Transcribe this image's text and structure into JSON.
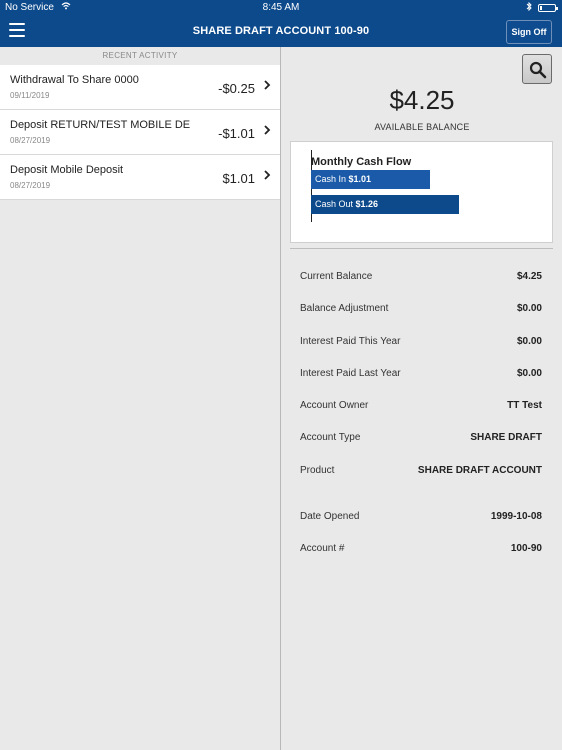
{
  "status_bar": {
    "carrier": "No Service",
    "time": "8:45 AM",
    "battery_level": 0.15
  },
  "header": {
    "title": "SHARE DRAFT ACCOUNT 100-90",
    "sign_off_label": "Sign Off",
    "background_color": "#0d4a8c"
  },
  "recent_activity": {
    "heading": "RECENT ACTIVITY",
    "items": [
      {
        "description": "Withdrawal To Share 0000",
        "date": "09/11/2019",
        "amount": "-$0.25"
      },
      {
        "description": "Deposit RETURN/TEST MOBILE DE",
        "date": "08/27/2019",
        "amount": "-$1.01"
      },
      {
        "description": "Deposit Mobile Deposit",
        "date": "08/27/2019",
        "amount": "$1.01"
      }
    ]
  },
  "summary": {
    "available_balance": "$4.25",
    "available_balance_label": "AVAILABLE BALANCE"
  },
  "cash_flow": {
    "title": "Monthly Cash Flow",
    "cash_in_label": "Cash In",
    "cash_in_value": "$1.01",
    "cash_out_label": "Cash Out",
    "cash_out_value": "$1.26",
    "cash_in_amount": 1.01,
    "cash_out_amount": 1.26,
    "cash_in_color": "#1a5aa8",
    "cash_out_color": "#0d4a8c"
  },
  "details": [
    {
      "label": "Current Balance",
      "value": "$4.25"
    },
    {
      "label": "Balance Adjustment",
      "value": "$0.00"
    },
    {
      "label": "Interest Paid This Year",
      "value": "$0.00"
    },
    {
      "label": "Interest Paid Last Year",
      "value": "$0.00"
    },
    {
      "label": "Account Owner",
      "value": "TT Test"
    },
    {
      "label": "Account Type",
      "value": "SHARE DRAFT"
    },
    {
      "label": "Product",
      "value": "SHARE DRAFT ACCOUNT"
    },
    {
      "label": "Date Opened",
      "value": "1999-10-08"
    },
    {
      "label": "Account #",
      "value": "100-90"
    }
  ],
  "icons": {
    "menu": "hamburger-menu-icon",
    "search": "search-icon",
    "chevron": "chevron-right-icon"
  }
}
